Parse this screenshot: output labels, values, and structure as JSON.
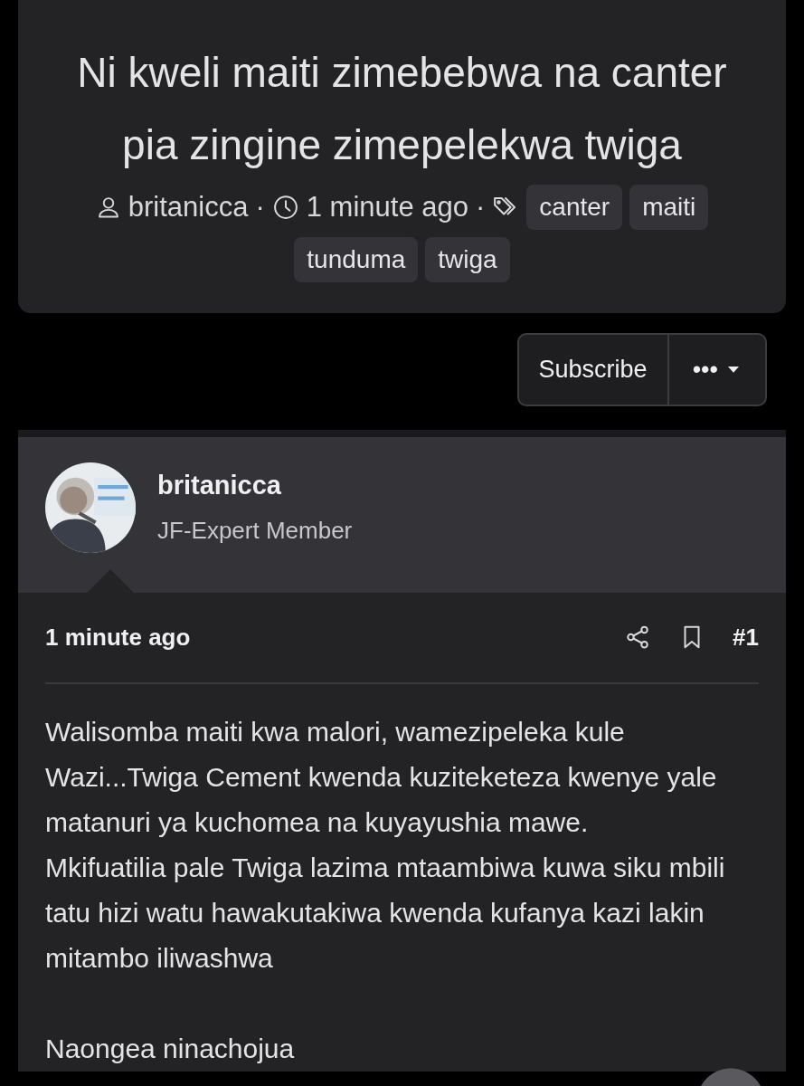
{
  "thread": {
    "title": "Ni kweli maiti zimebebwa na canter pia zingine zimepelekwa twiga",
    "author": "britanicca",
    "separator_1": "·",
    "time": "1 minute ago",
    "separator_2": "·",
    "tags": [
      "canter",
      "maiti",
      "tunduma",
      "twiga"
    ]
  },
  "actions": {
    "subscribe": "Subscribe",
    "more": "•••"
  },
  "post": {
    "author": "britanicca",
    "role": "JF-Expert Member",
    "time": "1 minute ago",
    "number": "#1",
    "paragraphs": [
      "Walisomba maiti kwa malori, wamezipeleka kule Wazi...Twiga Cement kwenda kuziteketeza kwenye yale matanuri ya kuchomea na kuyayushia mawe.\nMkifuatilia pale Twiga lazima mtaambiwa kuwa siku mbili tatu hizi watu hawakutakiwa kwenda kufanya kazi lakin mitambo iliwashwa",
      "Naongea ninachojua"
    ]
  }
}
